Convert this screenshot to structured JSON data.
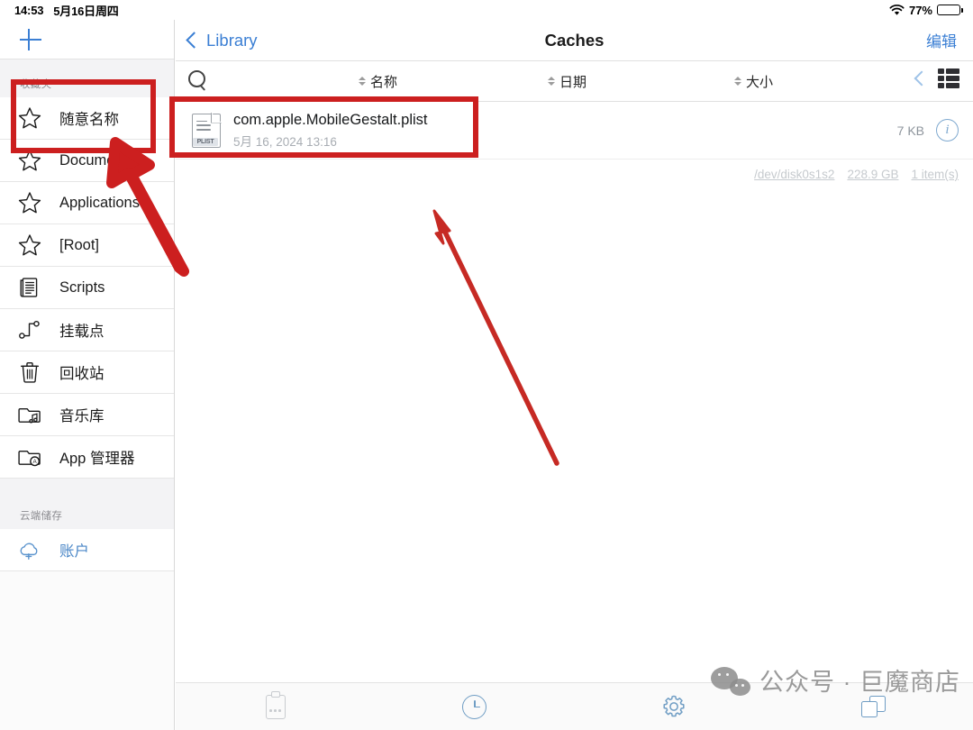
{
  "statusbar": {
    "time": "14:53",
    "date": "5月16日周四",
    "wifi_icon": "wifi-icon",
    "battery_percent": "77%",
    "battery_level": 77
  },
  "sidebar": {
    "add_button_icon": "plus-icon",
    "sections": [
      {
        "title": "收藏夹",
        "items": [
          {
            "label": "随意名称",
            "icon": "star-icon"
          },
          {
            "label": "Documents",
            "icon": "star-icon"
          },
          {
            "label": "Applications",
            "icon": "star-icon"
          },
          {
            "label": "[Root]",
            "icon": "star-icon"
          },
          {
            "label": "Scripts",
            "icon": "script-icon"
          },
          {
            "label": "挂载点",
            "icon": "mountpoint-icon"
          },
          {
            "label": "回收站",
            "icon": "trash-icon"
          },
          {
            "label": "音乐库",
            "icon": "music-folder-icon"
          },
          {
            "label": "App 管理器",
            "icon": "app-folder-icon"
          }
        ]
      },
      {
        "title": "云端储存",
        "items": [
          {
            "label": "账户",
            "icon": "cloud-plus-icon"
          }
        ]
      }
    ]
  },
  "navbar": {
    "back_label": "Library",
    "back_icon": "chevron-left-icon",
    "title": "Caches",
    "edit_label": "编辑"
  },
  "columnbar": {
    "search_icon": "search-icon",
    "columns": [
      {
        "label": "名称",
        "sort_icon": "sort-arrows-icon"
      },
      {
        "label": "日期",
        "sort_icon": "sort-arrows-icon"
      },
      {
        "label": "大小",
        "sort_icon": "sort-arrows-icon"
      }
    ],
    "collapse_icon": "chevron-left-icon",
    "view_icon": "list-view-icon"
  },
  "files": [
    {
      "name": "com.apple.MobileGestalt.plist",
      "date": "5月 16, 2024 13:16",
      "size": "7 KB",
      "type_badge": "PLIST",
      "info_icon": "info-circle-icon"
    }
  ],
  "volume_info": {
    "device": "/dev/disk0s1s2",
    "capacity": "228.9 GB",
    "item_count": "1 item(s)"
  },
  "toolbar": {
    "buttons": [
      {
        "icon": "clipboard-icon",
        "enabled": false
      },
      {
        "icon": "clock-icon",
        "enabled": true
      },
      {
        "icon": "gear-icon",
        "enabled": true
      },
      {
        "icon": "windows-icon",
        "enabled": true
      }
    ]
  },
  "watermark": {
    "logo_icon": "wechat-icon",
    "text": "公众号 · 巨魔商店"
  },
  "annotations": {
    "accent_color": "#cc1f1f",
    "boxes": [
      {
        "name": "sidebar-favorite-highlight"
      },
      {
        "name": "file-row-highlight"
      }
    ],
    "arrows": [
      {
        "name": "arrow-to-favorite"
      },
      {
        "name": "arrow-to-empty-area"
      }
    ]
  }
}
